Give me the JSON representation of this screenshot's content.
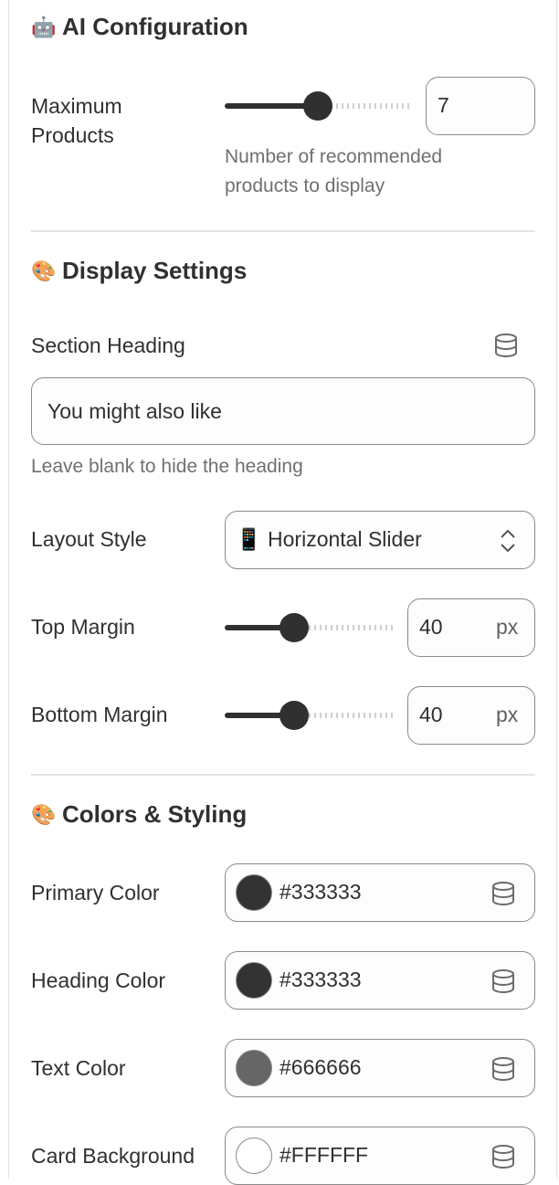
{
  "ai_config": {
    "title": "AI Configuration",
    "emoji": "🤖",
    "max_products": {
      "label": "Maximum Products",
      "value": "7",
      "slider_fraction": 0.5,
      "help": "Number of recommended products to display"
    }
  },
  "display": {
    "title": "Display Settings",
    "emoji": "🎨",
    "heading": {
      "label": "Section Heading",
      "value": "You might also like",
      "help": "Leave blank to hide the heading",
      "icon": "database-icon"
    },
    "layout": {
      "label": "Layout Style",
      "value": "📱 Horizontal Slider",
      "icon": "select-chevrons-icon"
    },
    "top_margin": {
      "label": "Top Margin",
      "value": "40",
      "unit": "px",
      "slider_fraction": 0.4
    },
    "bottom_margin": {
      "label": "Bottom Margin",
      "value": "40",
      "unit": "px",
      "slider_fraction": 0.4
    }
  },
  "colors": {
    "title": "Colors & Styling",
    "emoji": "🎨",
    "items": [
      {
        "label": "Primary Color",
        "value": "#333333",
        "swatch": "#333333"
      },
      {
        "label": "Heading Color",
        "value": "#333333",
        "swatch": "#333333"
      },
      {
        "label": "Text Color",
        "value": "#666666",
        "swatch": "#666666"
      },
      {
        "label": "Card Background",
        "value": "#FFFFFF",
        "swatch": "#FFFFFF"
      }
    ]
  }
}
